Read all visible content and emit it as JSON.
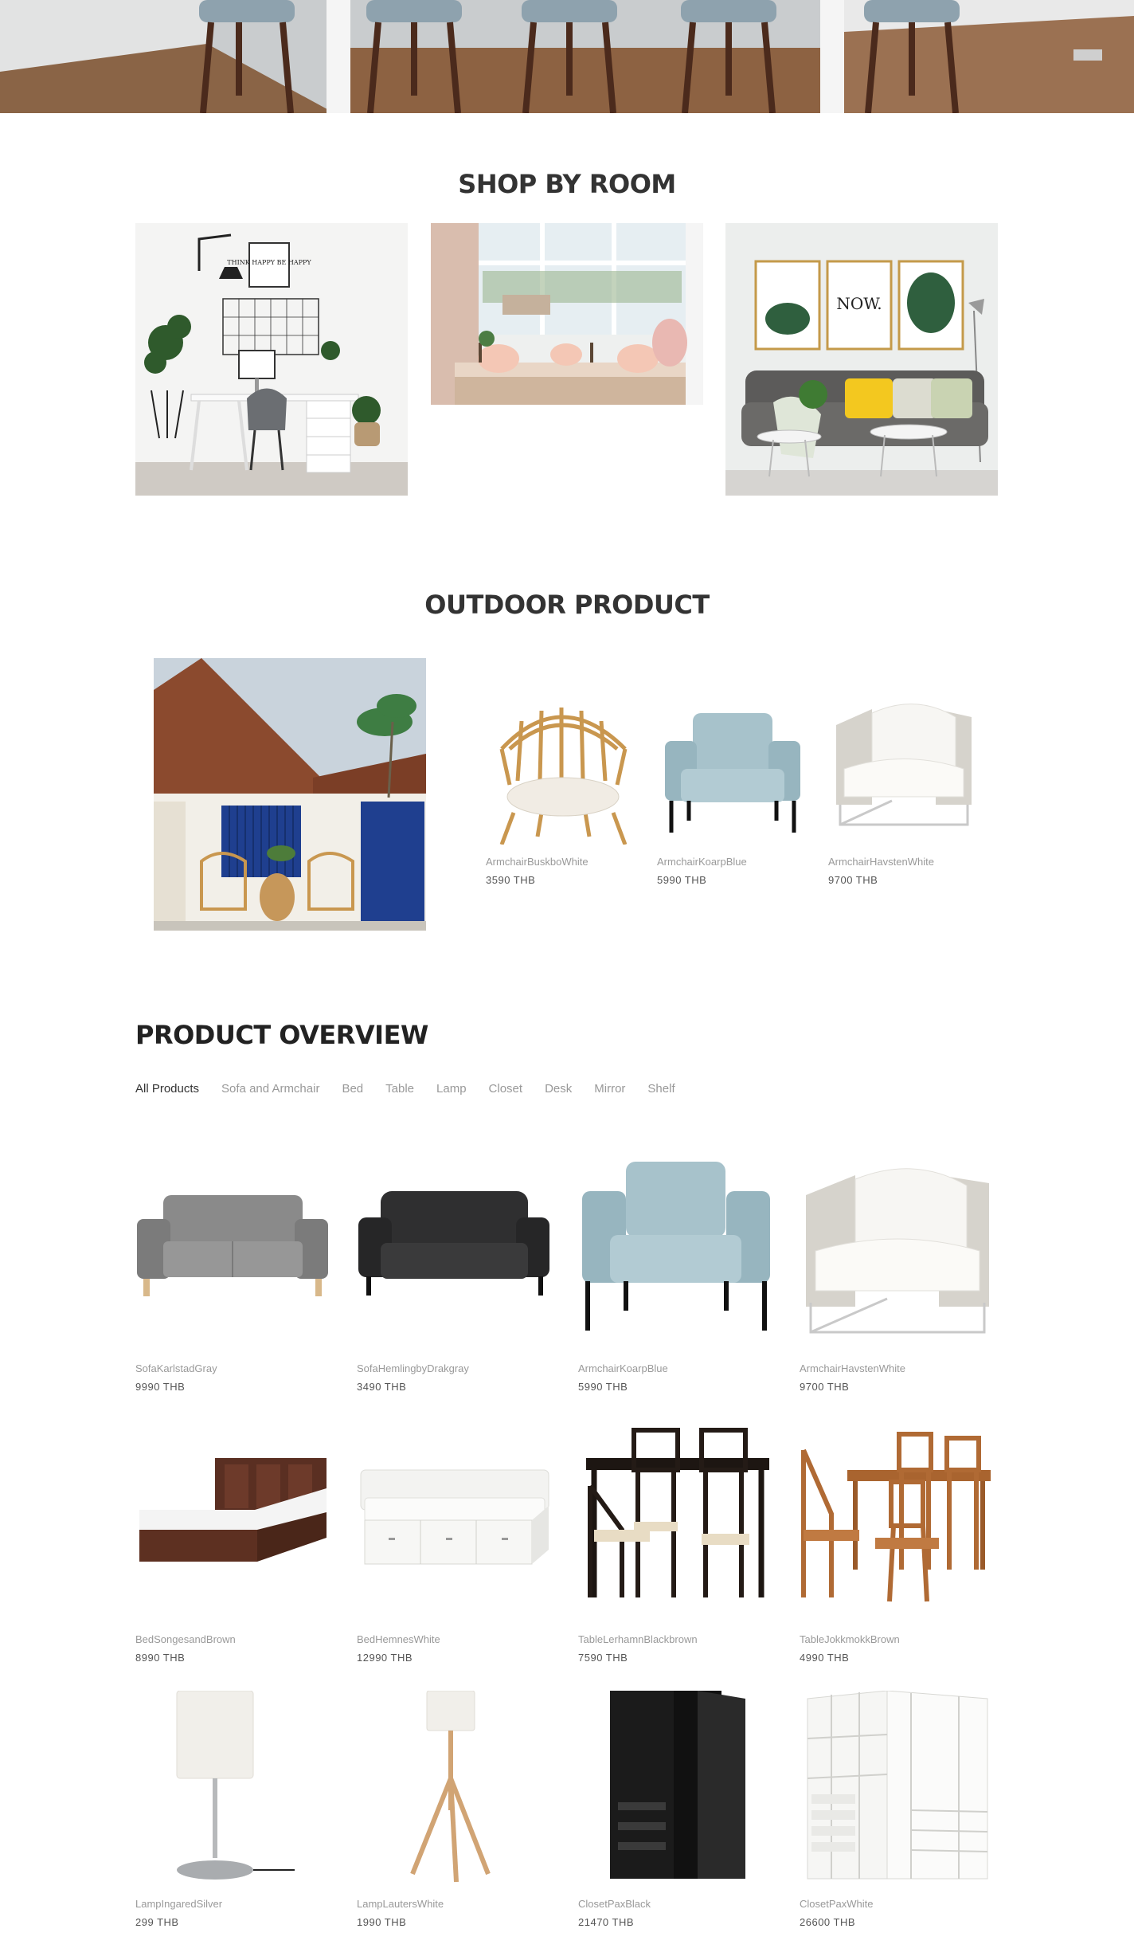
{
  "colors": {
    "heading": "#333333",
    "muted_text": "#999999",
    "price_text": "#555555",
    "active_filter": "#333333"
  },
  "sections": {
    "shop_by_room": {
      "title": "SHOP BY ROOM",
      "rooms": [
        {
          "name": "home-office",
          "poster_text": "THINK HAPPY BE HAPPY"
        },
        {
          "name": "dining-room"
        },
        {
          "name": "living-room",
          "poster_text": "NOW."
        }
      ]
    },
    "outdoor": {
      "title": "OUTDOOR PRODUCT",
      "products": [
        {
          "name": "ArmchairBuskboWhite",
          "price": "3590 THB",
          "icon": "rattan-armchair-icon"
        },
        {
          "name": "ArmchairKoarpBlue",
          "price": "5990 THB",
          "icon": "blue-armchair-icon"
        },
        {
          "name": "ArmchairHavstenWhite",
          "price": "9700 THB",
          "icon": "white-armchair-icon"
        }
      ]
    },
    "overview": {
      "title": "PRODUCT OVERVIEW",
      "filters": [
        "All Products",
        "Sofa and Armchair",
        "Bed",
        "Table",
        "Lamp",
        "Closet",
        "Desk",
        "Mirror",
        "Shelf"
      ],
      "active_filter": "All Products",
      "products": [
        {
          "name": "SofaKarlstadGray",
          "price": "9990 THB"
        },
        {
          "name": "SofaHemlingbyDrakgray",
          "price": "3490 THB"
        },
        {
          "name": "ArmchairKoarpBlue",
          "price": "5990 THB"
        },
        {
          "name": "ArmchairHavstenWhite",
          "price": "9700 THB"
        },
        {
          "name": "BedSongesandBrown",
          "price": "8990 THB"
        },
        {
          "name": "BedHemnesWhite",
          "price": "12990 THB"
        },
        {
          "name": "TableLerhamnBlackbrown",
          "price": "7590 THB"
        },
        {
          "name": "TableJokkmokkBrown",
          "price": "4990 THB"
        },
        {
          "name": "LampIngaredSilver",
          "price": "299 THB"
        },
        {
          "name": "LampLautersWhite",
          "price": "1990 THB"
        },
        {
          "name": "ClosetPaxBlack",
          "price": "21470 THB"
        },
        {
          "name": "ClosetPaxWhite",
          "price": "26600 THB"
        }
      ]
    }
  }
}
